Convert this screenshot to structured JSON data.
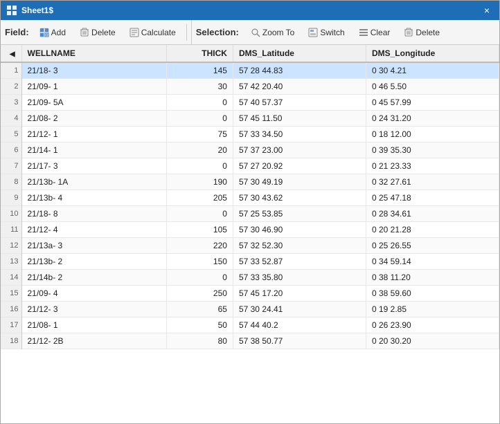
{
  "titleBar": {
    "icon": "⊞",
    "title": "Sheet1$",
    "closeLabel": "×"
  },
  "toolbar": {
    "fieldLabel": "Field:",
    "buttons": [
      {
        "id": "add",
        "label": "Add",
        "icon": "⊞"
      },
      {
        "id": "delete1",
        "label": "Delete",
        "icon": "🗑"
      },
      {
        "id": "calculate",
        "label": "Calculate",
        "icon": "≡"
      }
    ],
    "selectionLabel": "Selection:",
    "selectionButtons": [
      {
        "id": "zoomto",
        "label": "Zoom To",
        "icon": "🔍"
      },
      {
        "id": "switch",
        "label": "Switch",
        "icon": "⇄"
      },
      {
        "id": "clear",
        "label": "Clear",
        "icon": "☰"
      },
      {
        "id": "delete2",
        "label": "Delete",
        "icon": "🗑"
      }
    ]
  },
  "table": {
    "columns": [
      {
        "id": "rownum",
        "label": ""
      },
      {
        "id": "wellname",
        "label": "WELLNAME",
        "sorted": "asc"
      },
      {
        "id": "thick",
        "label": "THICK"
      },
      {
        "id": "dms_lat",
        "label": "DMS_Latitude"
      },
      {
        "id": "dms_lon",
        "label": "DMS_Longitude"
      }
    ],
    "rows": [
      {
        "rownum": 1,
        "wellname": "21/18- 3",
        "thick": "145",
        "dms_lat": "57 28 44.83",
        "dms_lon": "0 30 4.21",
        "selected": true
      },
      {
        "rownum": 2,
        "wellname": "21/09- 1",
        "thick": "30",
        "dms_lat": "57 42 20.40",
        "dms_lon": "0 46 5.50"
      },
      {
        "rownum": 3,
        "wellname": "21/09- 5A",
        "thick": "0",
        "dms_lat": "57 40 57.37",
        "dms_lon": "0 45 57.99"
      },
      {
        "rownum": 4,
        "wellname": "21/08- 2",
        "thick": "0",
        "dms_lat": "57 45 11.50",
        "dms_lon": "0 24 31.20"
      },
      {
        "rownum": 5,
        "wellname": "21/12- 1",
        "thick": "75",
        "dms_lat": "57 33 34.50",
        "dms_lon": "0 18 12.00"
      },
      {
        "rownum": 6,
        "wellname": "21/14- 1",
        "thick": "20",
        "dms_lat": "57 37 23.00",
        "dms_lon": "0 39 35.30"
      },
      {
        "rownum": 7,
        "wellname": "21/17- 3",
        "thick": "0",
        "dms_lat": "57 27 20.92",
        "dms_lon": "0 21 23.33"
      },
      {
        "rownum": 8,
        "wellname": "21/13b- 1A",
        "thick": "190",
        "dms_lat": "57 30 49.19",
        "dms_lon": "0 32 27.61"
      },
      {
        "rownum": 9,
        "wellname": "21/13b- 4",
        "thick": "205",
        "dms_lat": "57 30 43.62",
        "dms_lon": "0 25 47.18"
      },
      {
        "rownum": 10,
        "wellname": "21/18- 8",
        "thick": "0",
        "dms_lat": "57 25 53.85",
        "dms_lon": "0 28 34.61"
      },
      {
        "rownum": 11,
        "wellname": "21/12- 4",
        "thick": "105",
        "dms_lat": "57 30 46.90",
        "dms_lon": "0 20 21.28"
      },
      {
        "rownum": 12,
        "wellname": "21/13a- 3",
        "thick": "220",
        "dms_lat": "57 32 52.30",
        "dms_lon": "0 25 26.55"
      },
      {
        "rownum": 13,
        "wellname": "21/13b- 2",
        "thick": "150",
        "dms_lat": "57 33 52.87",
        "dms_lon": "0 34 59.14"
      },
      {
        "rownum": 14,
        "wellname": "21/14b- 2",
        "thick": "0",
        "dms_lat": "57 33 35.80",
        "dms_lon": "0 38 11.20"
      },
      {
        "rownum": 15,
        "wellname": "21/09- 4",
        "thick": "250",
        "dms_lat": "57 45 17.20",
        "dms_lon": "0 38 59.60"
      },
      {
        "rownum": 16,
        "wellname": "21/12- 3",
        "thick": "65",
        "dms_lat": "57 30 24.41",
        "dms_lon": "0 19 2.85"
      },
      {
        "rownum": 17,
        "wellname": "21/08- 1",
        "thick": "50",
        "dms_lat": "57 44 40.2",
        "dms_lon": "0 26 23.90"
      },
      {
        "rownum": 18,
        "wellname": "21/12- 2B",
        "thick": "80",
        "dms_lat": "57 38 50.77",
        "dms_lon": "0 20 30.20"
      }
    ]
  }
}
